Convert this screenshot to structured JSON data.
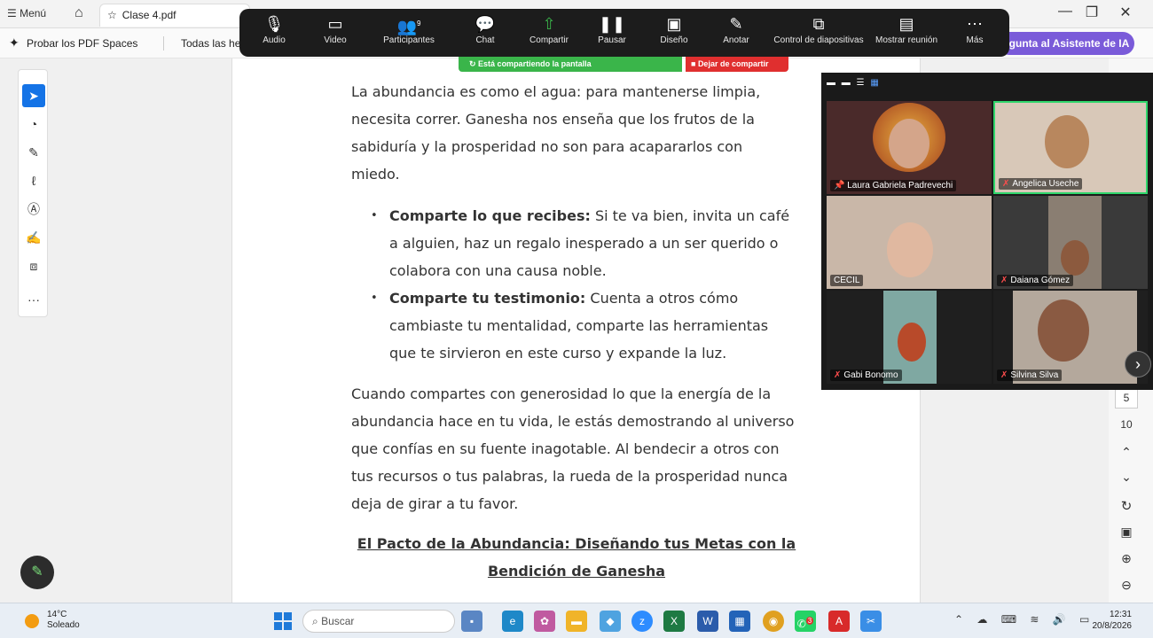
{
  "browser": {
    "menu_label": "☰ Menú",
    "tab_title": "Clase 4.pdf",
    "spaces_label": "Probar los PDF Spaces",
    "all_tools_label": "Todas las her",
    "ai_button_label": "egunta al Asistente de IA"
  },
  "zoom": {
    "items": [
      {
        "label": "Audio",
        "icon": "microphone-icon"
      },
      {
        "label": "Video",
        "icon": "video-camera-icon"
      },
      {
        "label": "Participantes",
        "icon": "participants-icon",
        "count": "9"
      },
      {
        "label": "Chat",
        "icon": "chat-icon"
      },
      {
        "label": "Compartir",
        "icon": "share-screen-icon"
      },
      {
        "label": "Pausar",
        "icon": "pause-icon"
      },
      {
        "label": "Diseño",
        "icon": "layout-icon"
      },
      {
        "label": "Anotar",
        "icon": "pencil-icon"
      },
      {
        "label": "Control de diapositivas",
        "icon": "slides-icon"
      },
      {
        "label": "Mostrar reunión",
        "icon": "show-meeting-icon"
      },
      {
        "label": "Más",
        "icon": "more-icon"
      }
    ],
    "sharing_text": "Está compartiendo la pantalla",
    "stop_sharing": "Dejar de compartir",
    "colors": {
      "bar": "#1c1c1c",
      "share_green": "#3ab54a",
      "stop_red": "#e02f2f"
    }
  },
  "document": {
    "para1": "La abundancia es como el agua: para mantenerse limpia, necesita correr. Ganesha nos enseña que los frutos de la sabiduría y la prosperidad no son para acapararlos con miedo.",
    "bullets": [
      {
        "bold": "Comparte lo que recibes:",
        "text": " Si te va bien, invita un café a alguien, haz un regalo inesperado a un ser querido o colabora con una causa noble."
      },
      {
        "bold": "Comparte tu testimonio:",
        "text": " Cuenta a otros cómo cambiaste tu mentalidad, comparte las herramientas que te sirvieron en este curso y expande la luz."
      }
    ],
    "para2": "Cuando compartes con generosidad lo que la energía de la abundancia hace en tu vida, le estás demostrando al universo que confías en su fuente inagotable. Al bendecir a otros con tus recursos o tus palabras, la rueda de la prosperidad nunca deja de girar a tu favor.",
    "heading": "El Pacto de la Abundancia: Diseñando tus Metas con la Bendición de Ganesha"
  },
  "right_nav": {
    "page_current": "5",
    "page_total": "10"
  },
  "participants": [
    {
      "name": "Laura Gabriela Padrevechi",
      "muted": false
    },
    {
      "name": "Angelica Useche",
      "muted": true
    },
    {
      "name": "CECIL",
      "muted": false
    },
    {
      "name": "Daiana Gómez",
      "muted": true
    },
    {
      "name": "Gabi Bonomo",
      "muted": true
    },
    {
      "name": "Silvina Silva",
      "muted": true
    }
  ],
  "taskbar": {
    "temperature": "14°C",
    "condition": "Soleado",
    "search_placeholder": "Buscar",
    "time": "12:31",
    "date": "20/8/2026",
    "whatsapp_badge": "3"
  }
}
